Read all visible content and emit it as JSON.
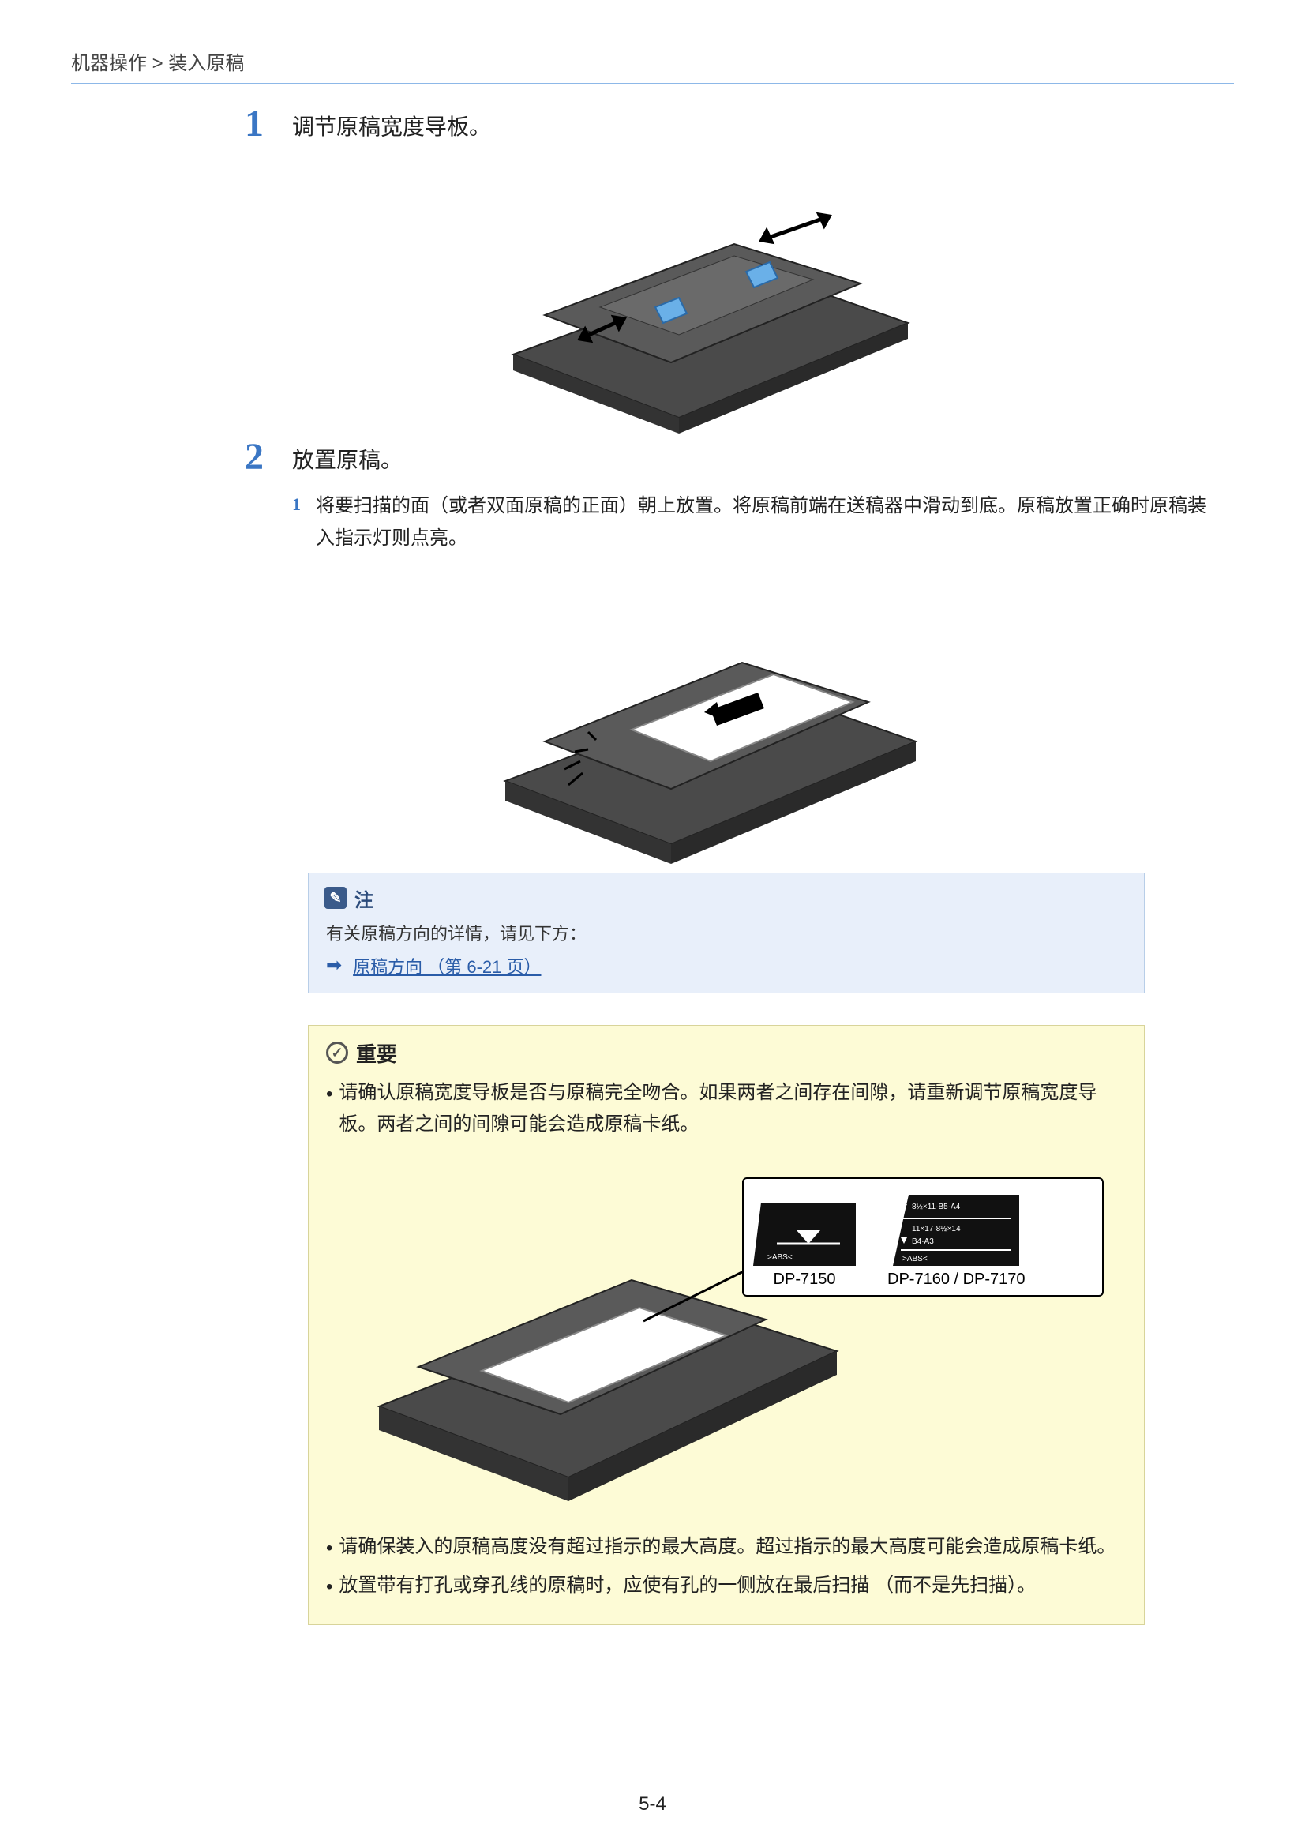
{
  "breadcrumb": "机器操作 > 装入原稿",
  "step1": {
    "number": "1",
    "title": "调节原稿宽度导板。"
  },
  "step2": {
    "number": "2",
    "title": "放置原稿。",
    "sub1": {
      "number": "1",
      "text": "将要扫描的面（或者双面原稿的正面）朝上放置。将原稿前端在送稿器中滑动到底。原稿放置正确时原稿装入指示灯则点亮。"
    }
  },
  "note": {
    "label": "注",
    "text": "有关原稿方向的详情，请见下方：",
    "link": "原稿方向 （第 6-21 页）"
  },
  "important": {
    "label": "重要",
    "bullet1": "请确认原稿宽度导板是否与原稿完全吻合。如果两者之间存在间隙，请重新调节原稿宽度导板。两者之间的间隙可能会造成原稿卡纸。",
    "bullet2": "请确保装入的原稿高度没有超过指示的最大高度。超过指示的最大高度可能会造成原稿卡纸。",
    "bullet3": "放置带有打孔或穿孔线的原稿时，应使有孔的一侧放在最后扫描 （而不是先扫描）。",
    "label_left": "DP-7150",
    "label_right": "DP-7160 / DP-7170",
    "abs_text": ">ABS<",
    "size_line1": "8½×11·B5·A4",
    "size_line2": "11×17·8½×14",
    "size_line3": "B4·A3"
  },
  "page_number": "5-4"
}
